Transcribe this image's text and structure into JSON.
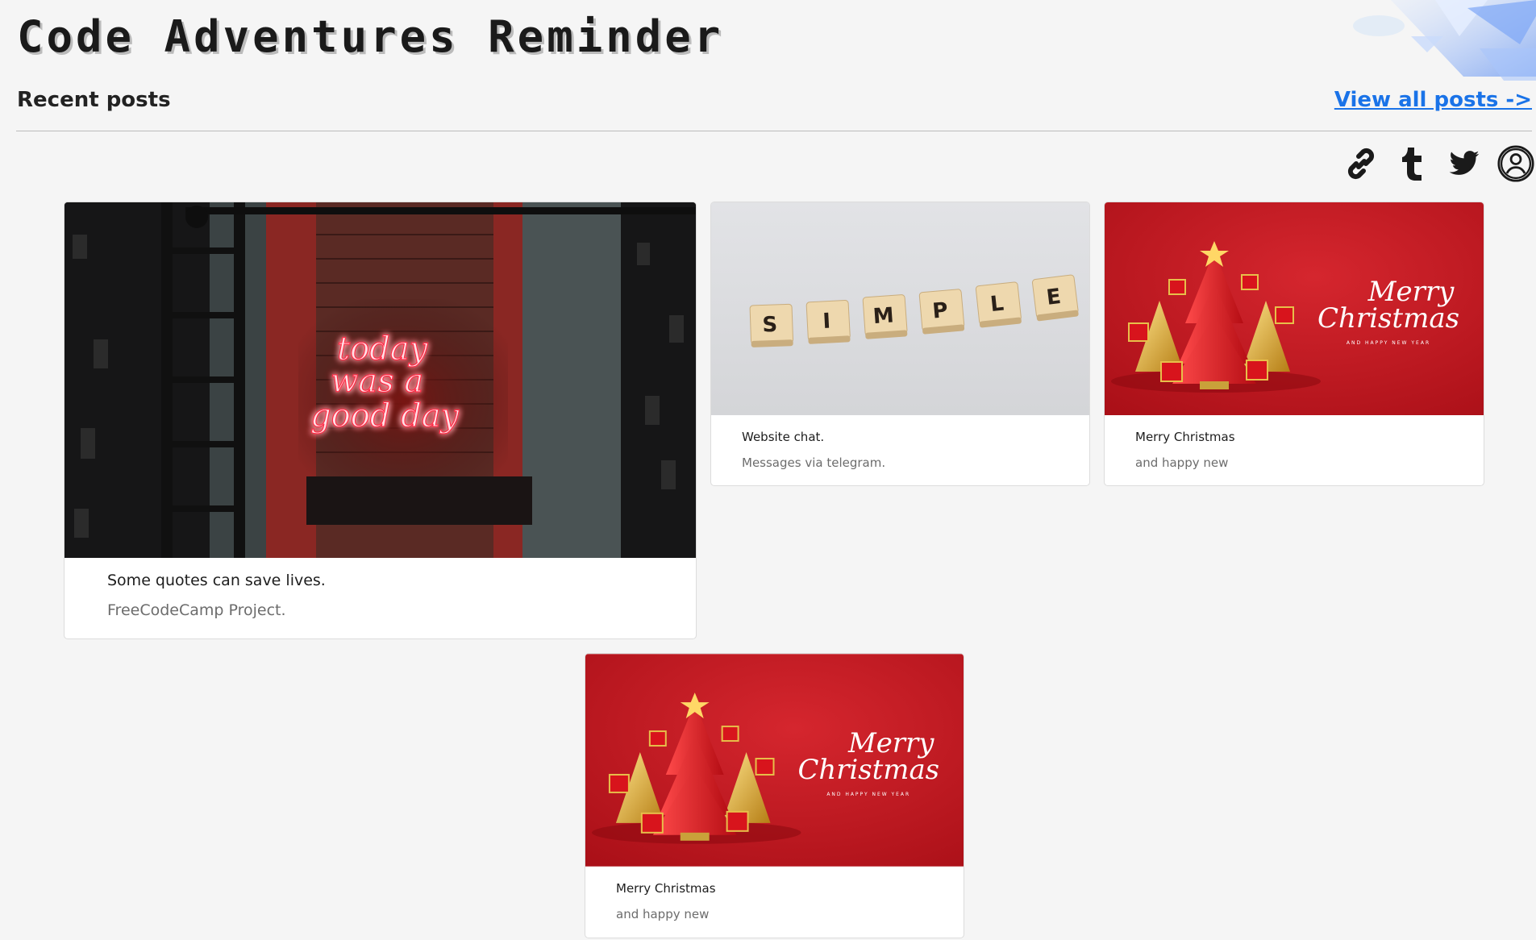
{
  "site": {
    "title": "Code Adventures Reminder"
  },
  "posts_section": {
    "title": "Recent posts",
    "view_all_label": "View all posts ->"
  },
  "social_icons": [
    "link-icon",
    "tumblr-icon",
    "twitter-icon",
    "profile-icon"
  ],
  "posts": [
    {
      "title": "Some quotes can save lives.",
      "subtitle": "FreeCodeCamp Project.",
      "image": "neon-sign-brick-wall",
      "image_text": [
        "today",
        "was a",
        "good day"
      ]
    },
    {
      "title": "Website chat.",
      "subtitle": "Messages via telegram.",
      "image": "scrabble-tiles",
      "image_text": [
        "S",
        "I",
        "M",
        "P",
        "L",
        "E"
      ]
    },
    {
      "title": "Merry Christmas",
      "subtitle": "and happy new",
      "image": "christmas-card",
      "image_text": [
        "Merry",
        "Christmas",
        "AND HAPPY NEW YEAR"
      ]
    },
    {
      "title": "Merry Christmas",
      "subtitle": "and happy new",
      "image": "christmas-card",
      "image_text": [
        "Merry",
        "Christmas",
        "AND HAPPY NEW YEAR"
      ]
    }
  ],
  "colors": {
    "link": "#1a73e8",
    "background": "#f5f5f5",
    "christmas_red": "#c8161e",
    "neon": "#ff3344"
  }
}
